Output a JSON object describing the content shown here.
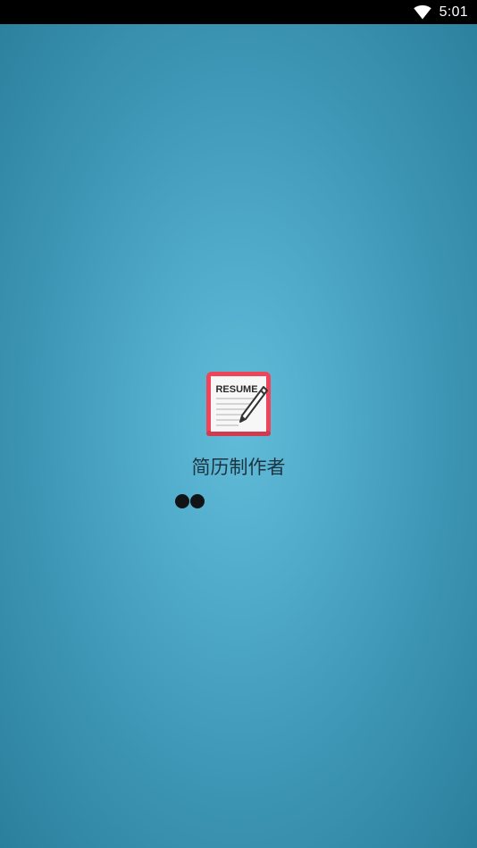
{
  "status_bar": {
    "time": "5:01",
    "icons": [
      "wifi-icon"
    ]
  },
  "splash": {
    "app_icon": {
      "name": "resume-icon",
      "label": "RESUME",
      "colors": {
        "frame": "#f0445b",
        "paper": "#f7f7f7",
        "lines": "#c9c9c9",
        "pencil": "#333333"
      }
    },
    "app_name": "简历制作者",
    "loading_dots": 2
  },
  "colors": {
    "background_center": "#61bcd9",
    "background_edge": "#2a7f9c",
    "status_bar": "#000000",
    "app_name_text": "#1d3440",
    "dot": "#111416"
  }
}
